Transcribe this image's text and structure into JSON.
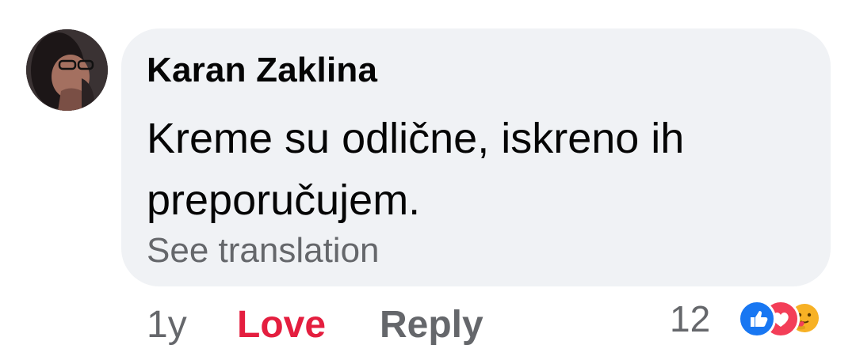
{
  "comment": {
    "author": "Karan Zaklina",
    "text": "Kreme su odlične, iskreno ih preporučujem.",
    "see_translation_label": "See translation",
    "age": "1y",
    "love_label": "Love",
    "reply_label": "Reply",
    "reaction_count": "12",
    "reaction_icons": [
      "like-icon",
      "love-icon",
      "care-icon"
    ]
  },
  "colors": {
    "bubble_bg": "#f0f2f5",
    "text": "#050505",
    "secondary_text": "#65676b",
    "love_active": "#e41e3f",
    "like_blue": "#1877f2",
    "love_red": "#f33e58"
  }
}
